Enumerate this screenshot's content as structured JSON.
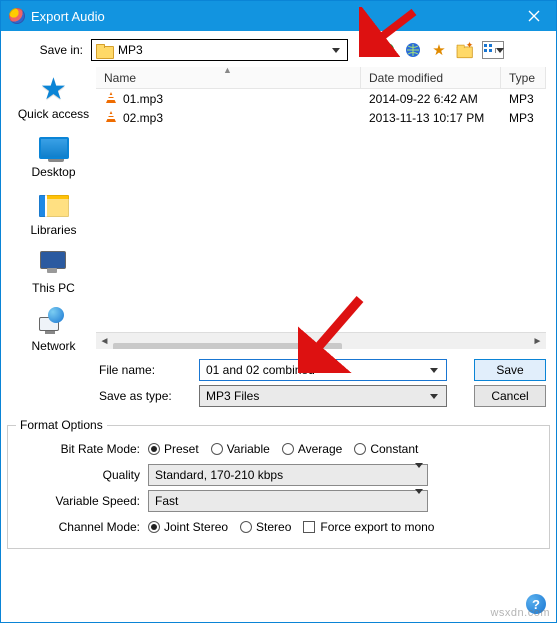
{
  "window": {
    "title": "Export Audio"
  },
  "labels": {
    "save_in": "Save in:",
    "file_name": "File name:",
    "save_as_type": "Save as type:",
    "format_options": "Format Options",
    "bit_rate_mode": "Bit Rate Mode:",
    "quality": "Quality",
    "variable_speed": "Variable Speed:",
    "channel_mode": "Channel Mode:"
  },
  "save_in": {
    "selected": "MP3"
  },
  "columns": {
    "name": "Name",
    "date": "Date modified",
    "type": "Type"
  },
  "files": [
    {
      "name": "01.mp3",
      "date_modified": "2014-09-22 6:42 AM",
      "type": "MP3"
    },
    {
      "name": "02.mp3",
      "date_modified": "2013-11-13 10:17 PM",
      "type": "MP3"
    }
  ],
  "file_name_value": "01 and 02 combined",
  "save_as_type_value": "MP3 Files",
  "buttons": {
    "save": "Save",
    "cancel": "Cancel"
  },
  "format": {
    "bit_rate_mode": {
      "selected": "Preset",
      "options": {
        "preset": "Preset",
        "variable": "Variable",
        "average": "Average",
        "constant": "Constant"
      }
    },
    "quality_selected": "Standard, 170-210 kbps",
    "variable_speed_selected": "Fast",
    "channel_mode": {
      "selected": "Joint Stereo",
      "options": {
        "joint_stereo": "Joint Stereo",
        "stereo": "Stereo"
      }
    },
    "force_mono_label": "Force export to mono",
    "force_mono_checked": false
  },
  "sidebar": [
    {
      "key": "quick_access",
      "label": "Quick access"
    },
    {
      "key": "desktop",
      "label": "Desktop"
    },
    {
      "key": "libraries",
      "label": "Libraries"
    },
    {
      "key": "this_pc",
      "label": "This PC"
    },
    {
      "key": "network",
      "label": "Network"
    }
  ],
  "watermark": "wsxdn.com"
}
